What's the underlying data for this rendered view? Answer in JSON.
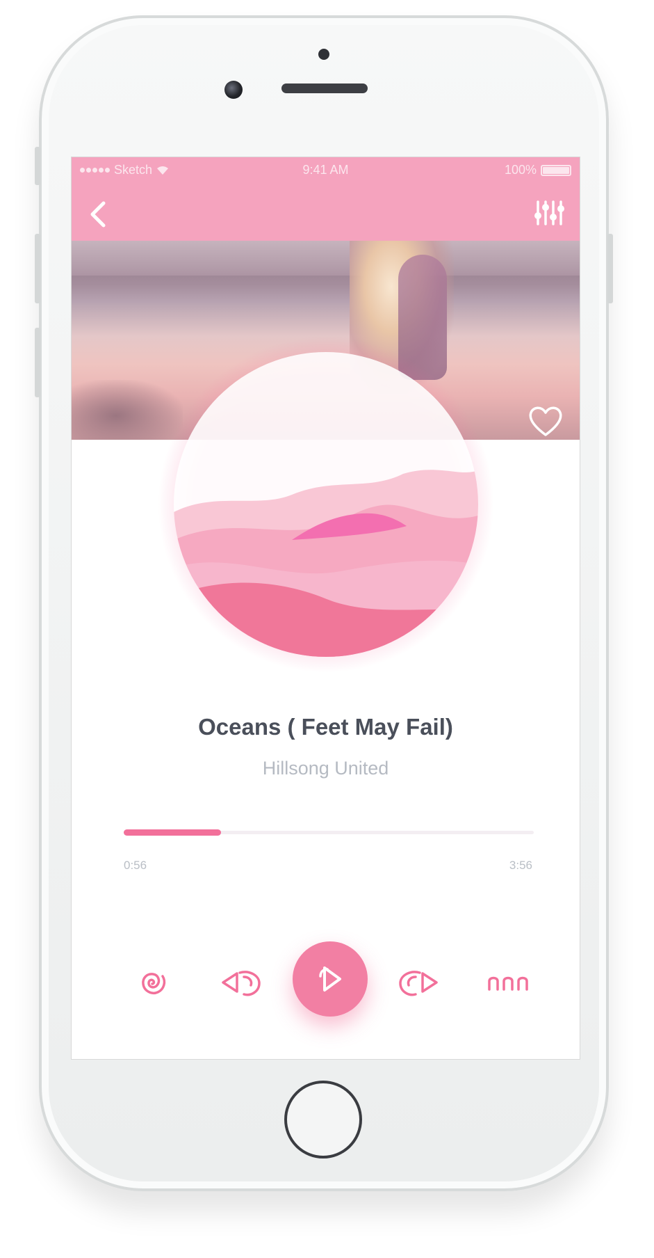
{
  "status_bar": {
    "carrier": "Sketch",
    "time": "9:41 AM",
    "battery": "100%"
  },
  "nav": {
    "back_icon": "chevron-left-icon",
    "equalizer_icon": "equalizer-icon"
  },
  "banner": {
    "favorite_icon": "heart-icon"
  },
  "track": {
    "title": "Oceans ( Feet May Fail)",
    "artist": "Hillsong United"
  },
  "progress": {
    "elapsed": "0:56",
    "total": "3:56",
    "fraction": 0.2373
  },
  "controls": {
    "shuffle_icon": "spiral-icon",
    "prev_icon": "previous-icon",
    "play_icon": "play-icon",
    "next_icon": "next-icon",
    "more_icon": "more-icon"
  },
  "colors": {
    "accent": "#f27fa3",
    "header": "#f5a3be",
    "title": "#4a4f5a",
    "subtitle": "#b5bac2"
  }
}
